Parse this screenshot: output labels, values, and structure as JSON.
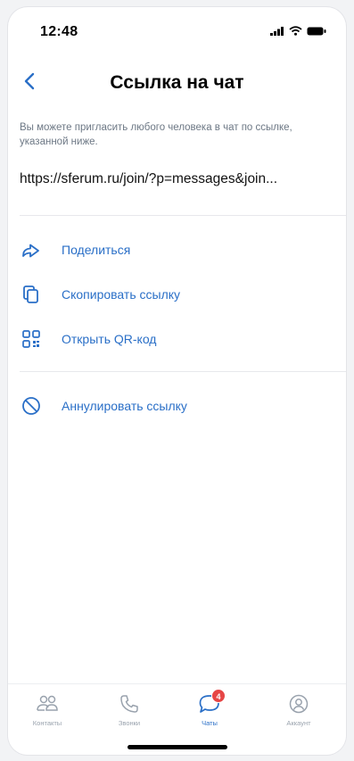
{
  "status_bar": {
    "time": "12:48"
  },
  "header": {
    "title": "Ссылка на чат"
  },
  "content": {
    "description": "Вы можете пригласить любого человека в чат по ссылке, указанной ниже.",
    "link": "https://sferum.ru/join/?p=messages&join..."
  },
  "actions": [
    {
      "label": "Поделиться",
      "icon": "share-icon"
    },
    {
      "label": "Скопировать ссылку",
      "icon": "copy-icon"
    },
    {
      "label": "Открыть QR-код",
      "icon": "qr-code-icon"
    },
    {
      "label": "Аннулировать ссылку",
      "icon": "block-icon"
    }
  ],
  "tabbar": {
    "tabs": [
      {
        "label": "Контакты",
        "icon": "contacts-icon"
      },
      {
        "label": "Звонки",
        "icon": "phone-icon"
      },
      {
        "label": "Чаты",
        "icon": "chat-icon",
        "badge": "4",
        "active": true
      },
      {
        "label": "Аккаунт",
        "icon": "account-icon"
      }
    ]
  },
  "colors": {
    "accent": "#2a6fc7",
    "secondary_text": "#6d7885",
    "badge": "#e64646"
  }
}
